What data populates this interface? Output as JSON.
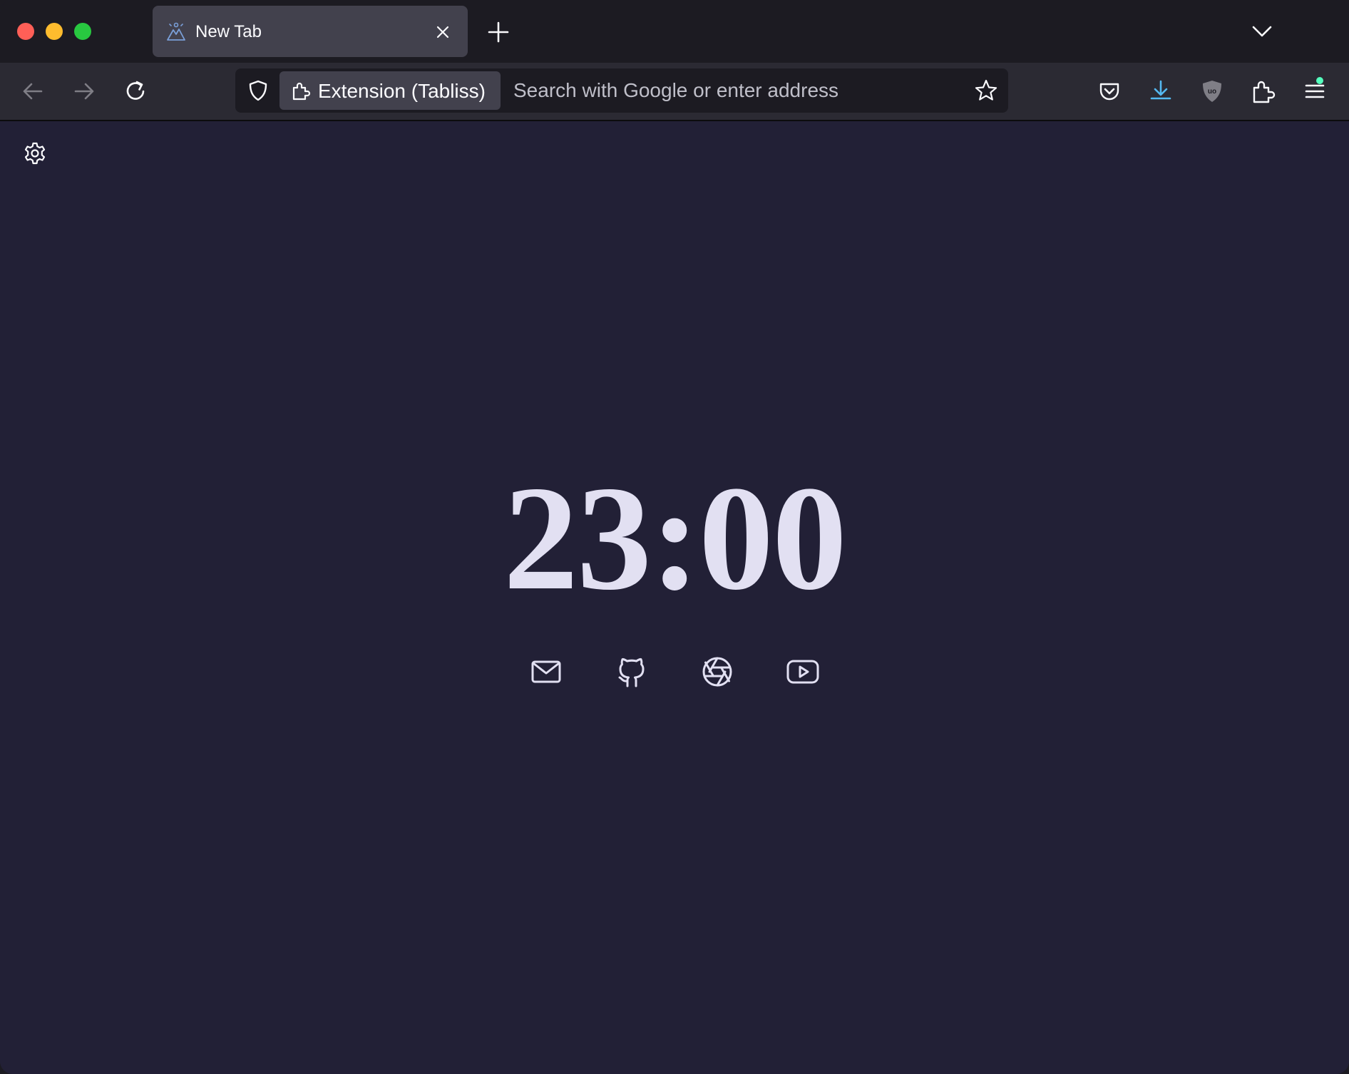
{
  "tab": {
    "title": "New Tab"
  },
  "urlbar": {
    "identity_label": "Extension (Tabliss)",
    "placeholder": "Search with Google or enter address",
    "value": ""
  },
  "clock": {
    "time": "23:00"
  },
  "quick_links": [
    {
      "icon": "mail-icon"
    },
    {
      "icon": "github-icon"
    },
    {
      "icon": "aperture-icon"
    },
    {
      "icon": "youtube-icon"
    }
  ],
  "colors": {
    "background": "#222036",
    "clock_text": "#e2e0f2",
    "toolbar": "#2b2a33",
    "tabstrip": "#1c1b22",
    "download_accent": "#54b8f0",
    "menu_badge": "#54ffbd"
  },
  "icons": {
    "back": "arrow-left-icon",
    "forward": "arrow-right-icon",
    "reload": "reload-icon",
    "tracking_protection": "shield-icon",
    "extension": "puzzle-icon",
    "bookmark": "star-icon",
    "pocket": "pocket-icon",
    "downloads": "download-icon",
    "ublock": "ublock-shield-icon",
    "extensions": "puzzle-icon",
    "menu": "hamburger-menu-icon",
    "settings": "gear-icon"
  }
}
